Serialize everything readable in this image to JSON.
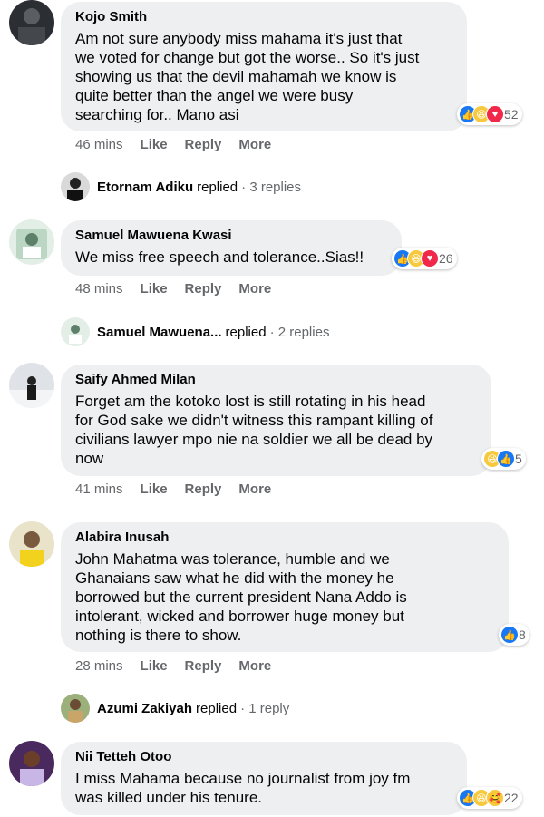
{
  "comments": [
    {
      "author": "Kojo Smith",
      "text": "Am not sure anybody miss mahama it's just that\nwe voted for change but got the worse.. So it's just\nshowing us that the devil mahamah we know is\nquite better than the angel we were busy\nsearching for.. Mano asi",
      "reaction_count": "52",
      "reactions": [
        "like",
        "haha",
        "love"
      ],
      "time": "46 mins",
      "actions": [
        "Like",
        "Reply",
        "More"
      ]
    },
    {
      "author": "Samuel Mawuena Kwasi",
      "text": "We miss free speech and tolerance..Sias!!",
      "reaction_count": "26",
      "reactions": [
        "like",
        "haha",
        "love"
      ],
      "time": "48 mins",
      "actions": [
        "Like",
        "Reply",
        "More"
      ]
    },
    {
      "author": "Saify Ahmed Milan",
      "text": "Forget am the kotoko lost is still rotating in his head\nfor God sake we didn't witness this rampant killing of\ncivilians lawyer mpo nie na soldier we all be dead by\nnow",
      "reaction_count": "5",
      "reactions": [
        "haha",
        "like"
      ],
      "time": "41 mins",
      "actions": [
        "Like",
        "Reply",
        "More"
      ]
    },
    {
      "author": "Alabira Inusah",
      "text": "John Mahatma was tolerance, humble and we\nGhanaians saw what he did with the money he\nborrowed but the current president Nana Addo is\nintolerant, wicked and borrower huge money but\nnothing is there to show.",
      "reaction_count": "8",
      "reactions": [
        "like"
      ],
      "time": "28 mins",
      "actions": [
        "Like",
        "Reply",
        "More"
      ]
    },
    {
      "author": "Nii Tetteh Otoo",
      "text": "I miss Mahama because no journalist from joy fm\nwas killed under his tenure.",
      "reaction_count": "22",
      "reactions": [
        "like",
        "haha",
        "care"
      ],
      "time": "",
      "actions": []
    }
  ],
  "replies": [
    {
      "name": "Etornam Adiku",
      "verb": "replied",
      "count": "· 3 replies"
    },
    {
      "name": "Samuel Mawuena...",
      "verb": "replied",
      "count": "· 2 replies"
    },
    {
      "name": "Azumi Zakiyah",
      "verb": "replied",
      "count": "· 1 reply"
    }
  ],
  "colors": {
    "bubble": "#eeeff1",
    "like": "#1877f2",
    "love": "#f02849",
    "haha": "#f7c93e",
    "meta": "#65676b"
  }
}
